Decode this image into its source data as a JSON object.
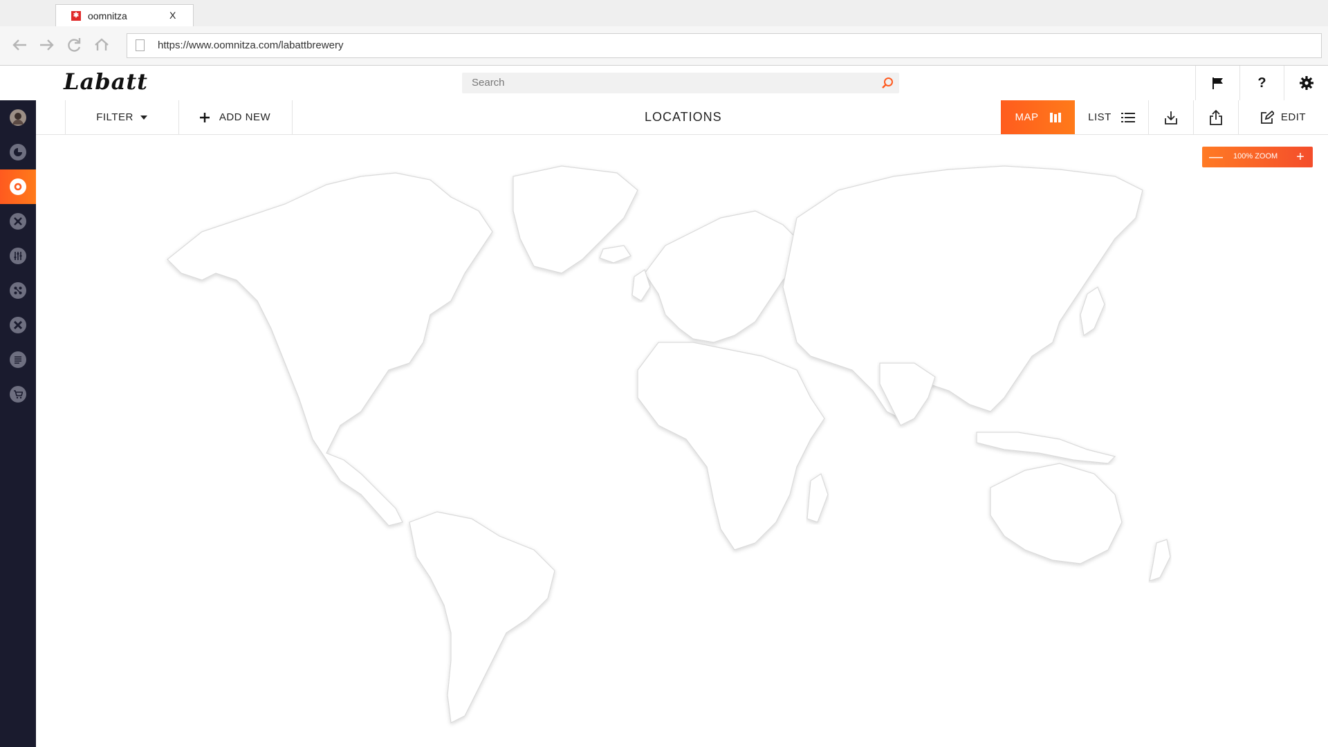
{
  "browser": {
    "tab_title": "oomnitza",
    "tab_close": "X",
    "url": "https://www.oomnitza.com/labattbrewery"
  },
  "header": {
    "brand": "Labatt",
    "search_placeholder": "Search",
    "icons": [
      "flag-icon",
      "help-icon",
      "settings-icon"
    ],
    "help_glyph": "?"
  },
  "sidebar": {
    "items": [
      "avatar",
      "dashboard-icon",
      "locations-icon",
      "assets-icon",
      "sliders-icon",
      "network-icon",
      "tools-icon",
      "list-icon",
      "cart-icon"
    ],
    "active_index": 2,
    "expand_glyph": ">"
  },
  "toolbar": {
    "filter_label": "FILTER",
    "add_new_label": "ADD NEW",
    "page_title": "LOCATIONS",
    "map_label": "MAP",
    "list_label": "LIST",
    "edit_label": "EDIT"
  },
  "map": {
    "zoom_label": "100% ZOOM",
    "zoom_out": "—",
    "zoom_in": "+"
  },
  "colors": {
    "accent": "#ff6a1f",
    "sidebar_bg": "#1a1b2e"
  }
}
